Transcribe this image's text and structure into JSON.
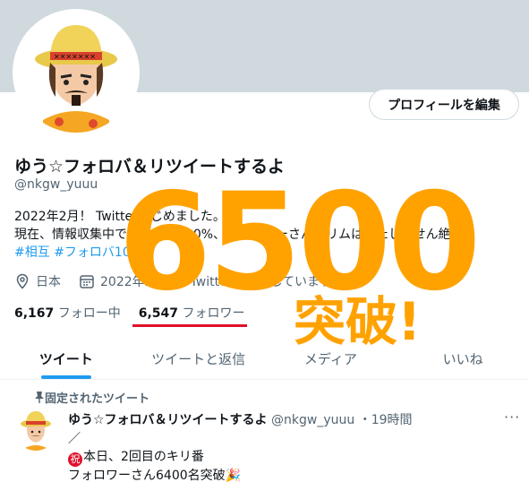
{
  "profile": {
    "edit_button": "プロフィールを編集",
    "name": "ゆう☆フォロバ＆リツイートするよ",
    "handle": "@nkgw_yuuu",
    "bio_line1": "2022年2月！ Twitterはじめました。",
    "bio_line2": "現在、情報収集中でフォロバ100%、フォロワーさんのリムはいたしません絶対！",
    "hashtag1": "#相互",
    "hashtag2": "#フォロバ100",
    "location": "日本",
    "joined": "2022年2月からTwitterを利用しています",
    "following_count": "6,167",
    "following_label": "フォロー中",
    "followers_count": "6,547",
    "followers_label": "フォロワー"
  },
  "tabs": [
    {
      "label": "ツイート"
    },
    {
      "label": "ツイートと返信"
    },
    {
      "label": "メディア"
    },
    {
      "label": "いいね"
    }
  ],
  "pinned_tweet": {
    "pinned_label": "固定されたツイート",
    "author": "ゆう☆フォロバ＆リツイートするよ",
    "handle": "@nkgw_yuuu",
    "time": "・19時間",
    "more": "···",
    "line1": "／",
    "iwai": "祝",
    "line2": "本日、2回目のキリ番",
    "line3": "フォロワーさん6400名突破🎉"
  },
  "overlay": {
    "number": "6500",
    "text": "突破!"
  },
  "colors": {
    "accent": "#1d9bf0",
    "overlay": "#ffa200",
    "underline": "#e0102a"
  }
}
